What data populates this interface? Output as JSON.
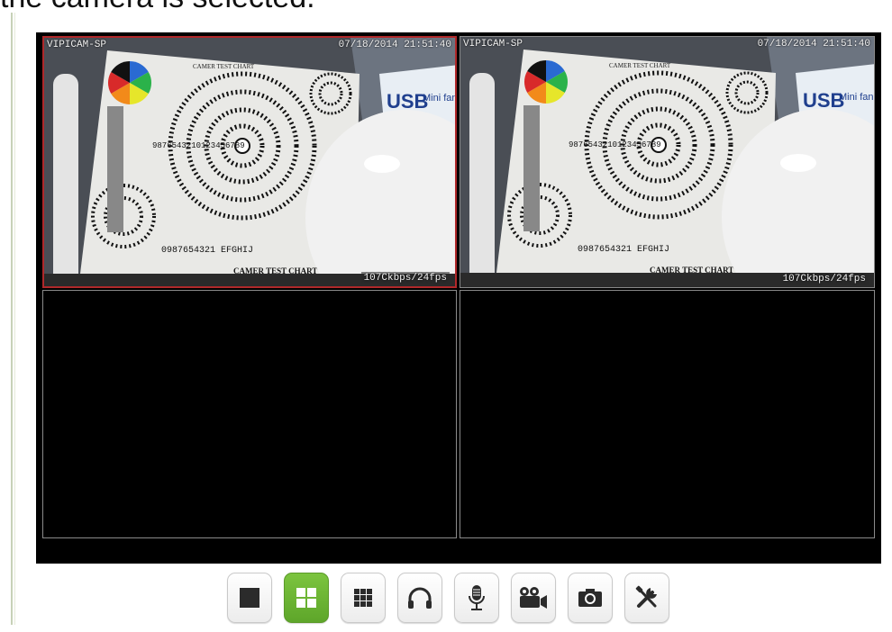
{
  "caption": "the camera is selected.",
  "colors": {
    "selected_border": "#b0282a",
    "active_button": "#6ab632",
    "frame_bg": "#000000"
  },
  "channels": [
    {
      "camera_name": "VIPICAM-SP",
      "timestamp": "07/18/2014 21:51:40",
      "bitrate": "107Ckbps/24fps",
      "selected": true,
      "has_video": true
    },
    {
      "camera_name": "VIPICAM-SP",
      "timestamp": "07/18/2014 21:51:40",
      "bitrate": "107Ckbps/24fps",
      "selected": false,
      "has_video": true
    },
    {
      "selected": false,
      "has_video": false
    },
    {
      "selected": false,
      "has_video": false
    }
  ],
  "feed_text": {
    "chart_title": "CAMER TEST CHART",
    "chart_footer": "CAMER TEST CHART",
    "box_label": "USB",
    "box_brand": "Mini fan"
  },
  "toolbar": [
    {
      "icon": "single-view-icon",
      "active": false
    },
    {
      "icon": "quad-view-icon",
      "active": true
    },
    {
      "icon": "nine-view-icon",
      "active": false
    },
    {
      "icon": "headphones-icon",
      "active": false
    },
    {
      "icon": "microphone-icon",
      "active": false
    },
    {
      "icon": "video-record-icon",
      "active": false
    },
    {
      "icon": "camera-snapshot-icon",
      "active": false
    },
    {
      "icon": "settings-tools-icon",
      "active": false
    }
  ]
}
